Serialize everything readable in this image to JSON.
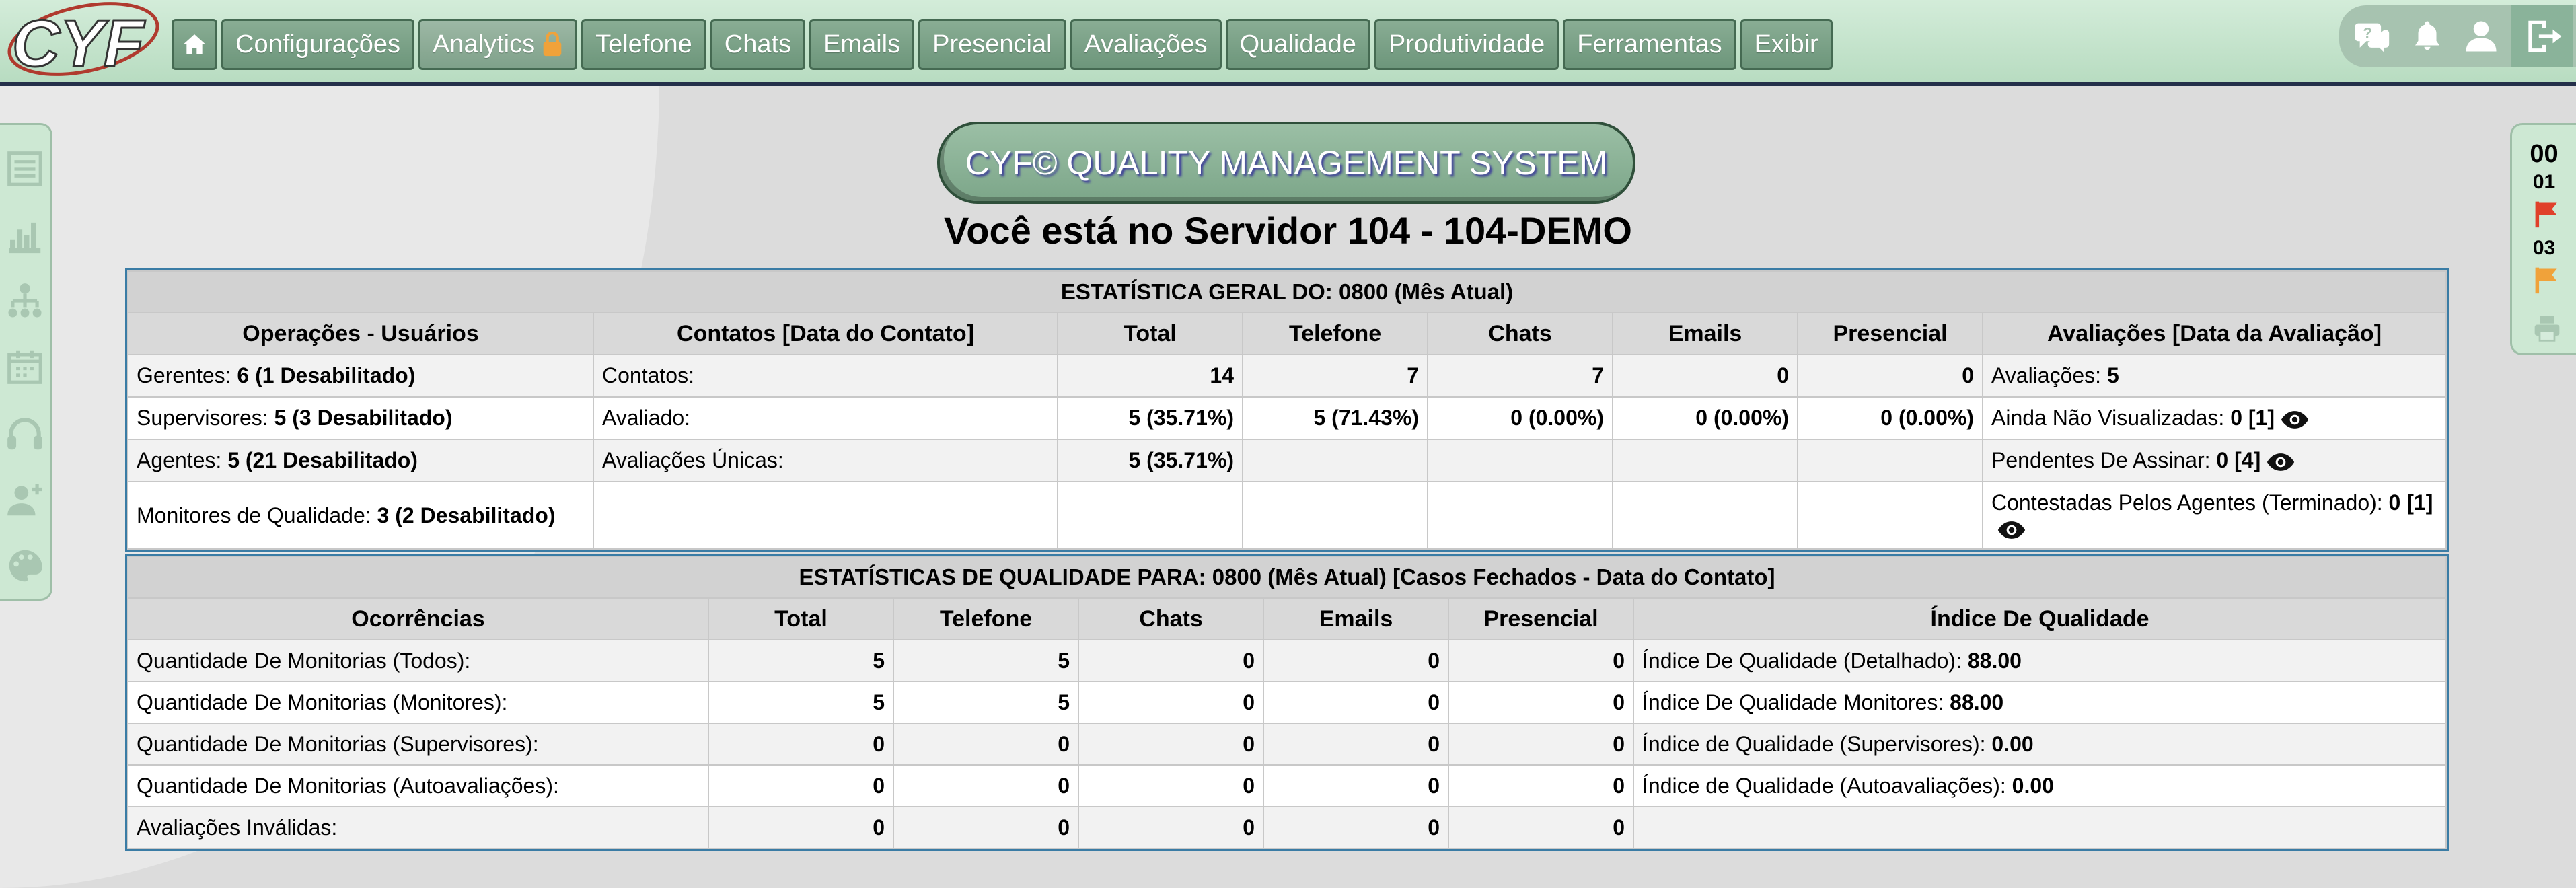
{
  "brand": {
    "logo_text": "CYF"
  },
  "nav": {
    "items": [
      {
        "label": "Configurações"
      },
      {
        "label": "Analytics"
      },
      {
        "label": "Telefone"
      },
      {
        "label": "Chats"
      },
      {
        "label": "Emails"
      },
      {
        "label": "Presencial"
      },
      {
        "label": "Avaliações"
      },
      {
        "label": "Qualidade"
      },
      {
        "label": "Produtividade"
      },
      {
        "label": "Ferramentas"
      },
      {
        "label": "Exibir"
      }
    ]
  },
  "right_panel": {
    "n1": "00",
    "n2": "01",
    "n3": "03"
  },
  "header": {
    "system_title": "CYF© QUALITY MANAGEMENT SYSTEM",
    "server_text": "Você está no Servidor 104 - 104-DEMO"
  },
  "general": {
    "title": "ESTATÍSTICA GERAL DO: 0800 (Mês Atual)",
    "headers": [
      "Operações - Usuários",
      "Contatos [Data do Contato]",
      "Total",
      "Telefone",
      "Chats",
      "Emails",
      "Presencial",
      "Avaliações [Data da Avaliação]"
    ],
    "rows": [
      {
        "users_label": "Gerentes: ",
        "users_value": "6 (1 Desabilitado)",
        "contacts_label": "Contatos:",
        "total": "14",
        "telefone": "7",
        "chats": "7",
        "emails": "0",
        "presencial": "0",
        "eval_label": "Avaliações: ",
        "eval_value": "5"
      },
      {
        "users_label": "Supervisores: ",
        "users_value": "5 (3 Desabilitado)",
        "contacts_label": "Avaliado:",
        "total": "5 (35.71%)",
        "telefone": "5 (71.43%)",
        "chats": "0 (0.00%)",
        "emails": "0 (0.00%)",
        "presencial": "0 (0.00%)",
        "eval_label": "Ainda Não Visualizadas: ",
        "eval_value": "0 [1]"
      },
      {
        "users_label": "Agentes: ",
        "users_value": "5 (21 Desabilitado)",
        "contacts_label": "Avaliações Únicas:",
        "total": "5 (35.71%)",
        "telefone": "",
        "chats": "",
        "emails": "",
        "presencial": "",
        "eval_label": "Pendentes De Assinar: ",
        "eval_value": "0 [4]"
      },
      {
        "users_label": "Monitores de Qualidade: ",
        "users_value": "3 (2 Desabilitado)",
        "contacts_label": "",
        "total": "",
        "telefone": "",
        "chats": "",
        "emails": "",
        "presencial": "",
        "eval_label": "Contestadas Pelos Agentes (Terminado): ",
        "eval_value": "0 [1]"
      }
    ]
  },
  "quality": {
    "title": "ESTATÍSTICAS DE QUALIDADE PARA: 0800 (Mês Atual) [Casos Fechados - Data do Contato]",
    "headers": [
      "Ocorrências",
      "Total",
      "Telefone",
      "Chats",
      "Emails",
      "Presencial",
      "Índice De Qualidade"
    ],
    "rows": [
      {
        "label": "Quantidade De Monitorias (Todos):",
        "total": "5",
        "telefone": "5",
        "chats": "0",
        "emails": "0",
        "presencial": "0",
        "idx_label": "Índice De Qualidade (Detalhado): ",
        "idx_value": "88.00"
      },
      {
        "label": "Quantidade De Monitorias (Monitores):",
        "total": "5",
        "telefone": "5",
        "chats": "0",
        "emails": "0",
        "presencial": "0",
        "idx_label": "Índice De Qualidade Monitores: ",
        "idx_value": "88.00"
      },
      {
        "label": "Quantidade De Monitorias (Supervisores):",
        "total": "0",
        "telefone": "0",
        "chats": "0",
        "emails": "0",
        "presencial": "0",
        "idx_label": "Índice de Qualidade (Supervisores): ",
        "idx_value": "0.00"
      },
      {
        "label": "Quantidade De Monitorias (Autoavaliações):",
        "total": "0",
        "telefone": "0",
        "chats": "0",
        "emails": "0",
        "presencial": "0",
        "idx_label": "Índice de Qualidade (Autoavaliações): ",
        "idx_value": "0.00"
      },
      {
        "label": "Avaliações Inválidas:",
        "total": "0",
        "telefone": "0",
        "chats": "0",
        "emails": "0",
        "presencial": "0",
        "idx_label": "",
        "idx_value": ""
      }
    ]
  }
}
